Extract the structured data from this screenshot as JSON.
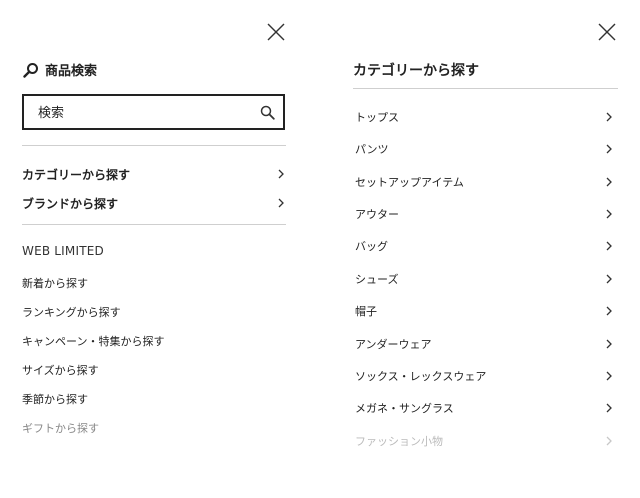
{
  "left_panel": {
    "search_title": "商品検索",
    "search_input": {
      "value": "",
      "placeholder": "検索"
    },
    "nav_items": [
      {
        "label": "カテゴリーから探す"
      },
      {
        "label": "ブランドから探す"
      }
    ],
    "section_heading": "WEB LIMITED",
    "links": [
      {
        "label": "新着から探す"
      },
      {
        "label": "ランキングから探す"
      },
      {
        "label": "キャンペーン・特集から探す"
      },
      {
        "label": "サイズから探す"
      },
      {
        "label": "季節から探す"
      },
      {
        "label": "ギフトから探す"
      }
    ]
  },
  "right_panel": {
    "title": "カテゴリーから探す",
    "categories": [
      {
        "label": "トップス"
      },
      {
        "label": "パンツ"
      },
      {
        "label": "セットアップアイテム"
      },
      {
        "label": "アウター"
      },
      {
        "label": "バッグ"
      },
      {
        "label": "シューズ"
      },
      {
        "label": "帽子"
      },
      {
        "label": "アンダーウェア"
      },
      {
        "label": "ソックス・レックスウェア"
      },
      {
        "label": "メガネ・サングラス"
      },
      {
        "label": "ファッション小物"
      }
    ]
  },
  "icons": {
    "close": "close-icon",
    "search": "search-icon",
    "chevron": "chevron-right-icon"
  },
  "colors": {
    "text": "#222222",
    "divider": "#cfcfcf",
    "muted_text": "#888888",
    "faded_text": "#bbbbbb",
    "background": "#ffffff"
  }
}
